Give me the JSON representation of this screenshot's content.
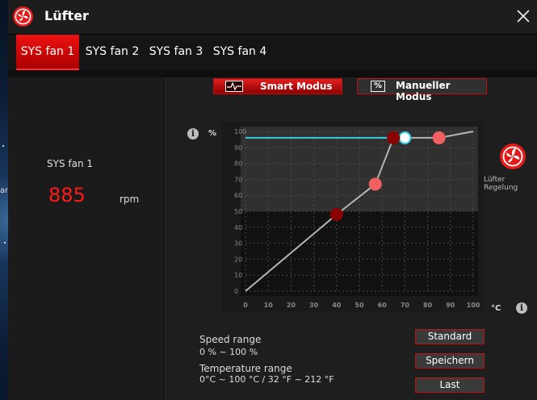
{
  "window": {
    "title": "Lüfter"
  },
  "tabs": [
    {
      "label": "SYS fan 1",
      "active": true
    },
    {
      "label": "SYS fan 2",
      "active": false
    },
    {
      "label": "SYS fan 3",
      "active": false
    },
    {
      "label": "SYS fan 4",
      "active": false
    }
  ],
  "fan": {
    "name": "SYS fan 1",
    "rpm": "885",
    "rpm_unit": "rpm"
  },
  "modes": {
    "smart": "Smart Modus",
    "manual": "Manueller Modus",
    "manual_badge": "%"
  },
  "chart_data": {
    "type": "line",
    "ylabel": "%",
    "xlabel": "°C",
    "x_ticks": [
      "0",
      "10",
      "20",
      "30",
      "40",
      "50",
      "60",
      "70",
      "80",
      "90",
      "100"
    ],
    "y_ticks": [
      "0",
      "10",
      "20",
      "30",
      "40",
      "50",
      "60",
      "70",
      "80",
      "90",
      "100"
    ],
    "xlim": [
      0,
      100
    ],
    "ylim": [
      0,
      100
    ],
    "series": [
      {
        "points": [
          [
            0,
            0
          ],
          [
            40,
            48
          ],
          [
            57,
            67
          ],
          [
            65,
            96
          ],
          [
            70,
            96
          ],
          [
            85,
            96
          ],
          [
            100,
            100
          ]
        ]
      }
    ],
    "control_points": [
      [
        40,
        48
      ],
      [
        57,
        67
      ],
      [
        65,
        96
      ],
      [
        85,
        96
      ]
    ],
    "current_temperature_marker": [
      70,
      96
    ],
    "cutoff_line_y": 96,
    "colors": {
      "curve": "#b4b4b4",
      "point_dark": "#8b0000",
      "point_light": "#f06060",
      "cutoff": "#30d0e0"
    }
  },
  "side": {
    "label": "Lüfter Regelung"
  },
  "info": {
    "speed_title": "Speed range",
    "speed_value": "0 % ~ 100 %",
    "temp_title": "Temperature range",
    "temp_value": "0°C ~ 100 °C / 32 °F ~ 212 °F"
  },
  "buttons": {
    "standard": "Standard",
    "save": "Speichern",
    "load": "Last"
  },
  "background": {
    "label": "an"
  }
}
